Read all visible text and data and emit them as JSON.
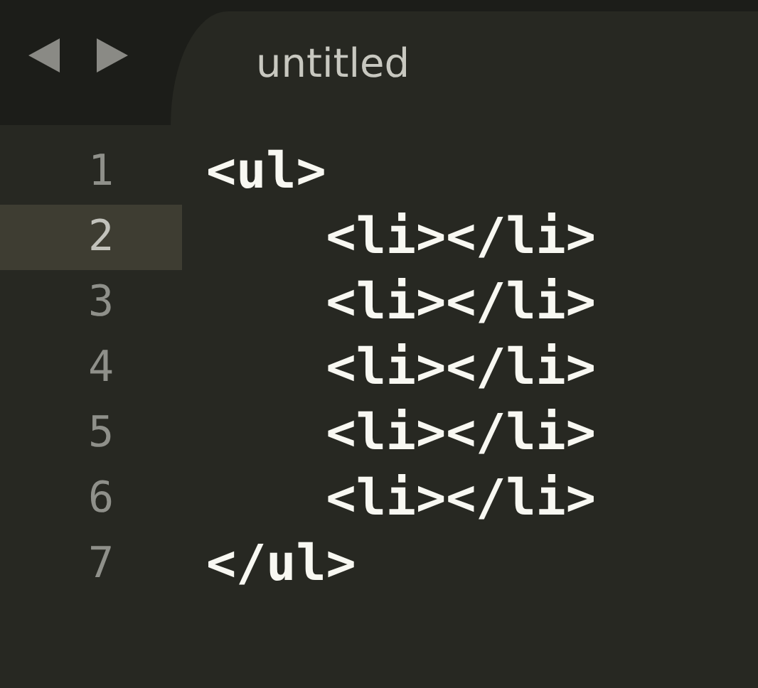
{
  "tabs": [
    {
      "title": "untitled",
      "selected": true
    }
  ],
  "lines": [
    {
      "number": "1",
      "text": "<ul>",
      "current": false
    },
    {
      "number": "2",
      "text": "    <li></li>",
      "current": true
    },
    {
      "number": "3",
      "text": "    <li></li>",
      "current": false
    },
    {
      "number": "4",
      "text": "    <li></li>",
      "current": false
    },
    {
      "number": "5",
      "text": "    <li></li>",
      "current": false
    },
    {
      "number": "6",
      "text": "    <li></li>",
      "current": false
    },
    {
      "number": "7",
      "text": "</ul>",
      "current": false
    }
  ]
}
